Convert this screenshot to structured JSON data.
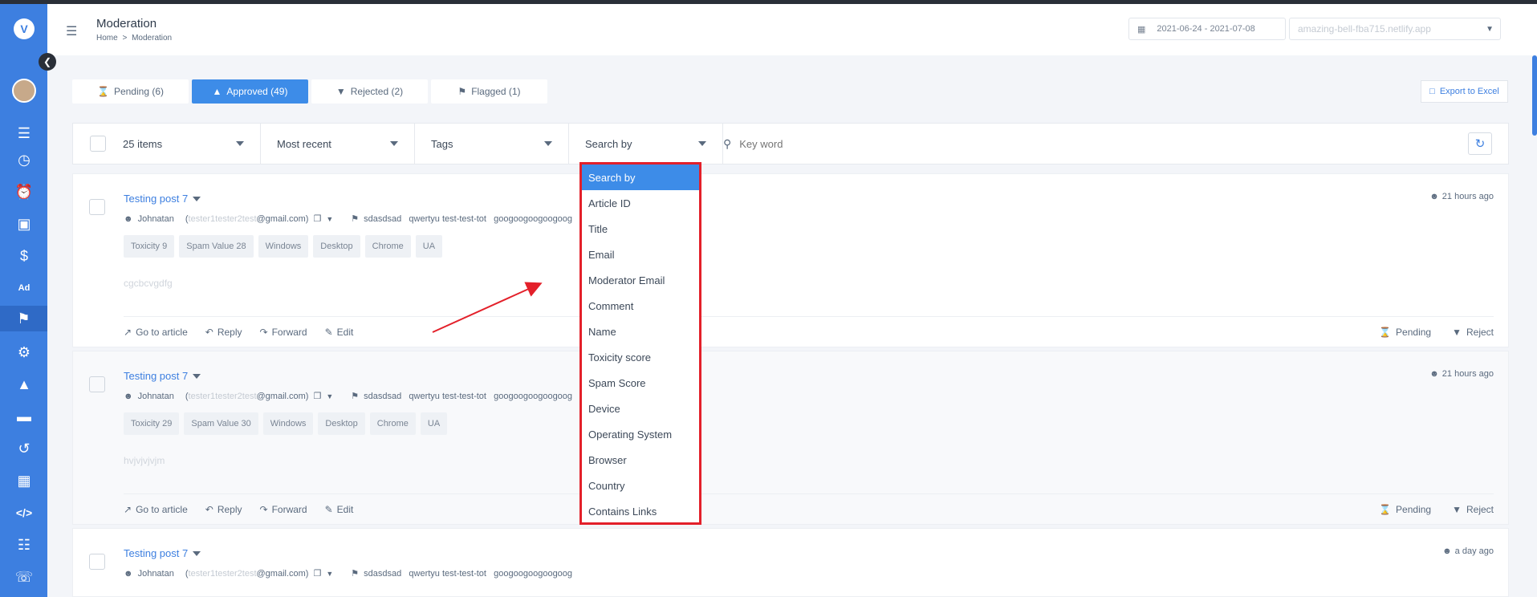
{
  "header": {
    "title": "Moderation",
    "breadcrumb_home": "Home",
    "breadcrumb_sep": ">",
    "breadcrumb_current": "Moderation",
    "date_range": "2021-06-24 - 2021-07-08",
    "site": "amazing-bell-fba715.netlify.app"
  },
  "tabs": [
    {
      "label": "Pending (6)",
      "icon": "hourglass-icon"
    },
    {
      "label": "Approved (49)",
      "icon": "thumbs-up-icon"
    },
    {
      "label": "Rejected (2)",
      "icon": "thumbs-down-icon"
    },
    {
      "label": "Flagged (1)",
      "icon": "flag-icon"
    }
  ],
  "export_label": "Export to Excel",
  "filters": {
    "items": "25 items",
    "sort": "Most recent",
    "tags": "Tags",
    "search_by": "Search by",
    "keyword_placeholder": "Key word"
  },
  "dropdown": {
    "options": [
      "Search by",
      "Article ID",
      "Title",
      "Email",
      "Moderator Email",
      "Comment",
      "Name",
      "Toxicity score",
      "Spam Score",
      "Device",
      "Operating System",
      "Browser",
      "Country",
      "Contains Links"
    ]
  },
  "posts": [
    {
      "title": "Testing post 7",
      "author": "Johnatan",
      "email_prefix": "(",
      "email_muted": "tester1tester2test",
      "email_rest": "@gmail.com)",
      "tags_line": "sdasdsad   qwertyu test-test-tot   googoogoogoogoog",
      "chips": [
        "Toxicity 9",
        "Spam Value 28",
        "Windows",
        "Desktop",
        "Chrome",
        "UA"
      ],
      "body": "cgcbcvgdfg",
      "time": "21 hours ago"
    },
    {
      "title": "Testing post 7",
      "author": "Johnatan",
      "email_prefix": "(",
      "email_muted": "tester1tester2test",
      "email_rest": "@gmail.com)",
      "tags_line": "sdasdsad   qwertyu test-test-tot   googoogoogoogoog",
      "chips": [
        "Toxicity 29",
        "Spam Value 30",
        "Windows",
        "Desktop",
        "Chrome",
        "UA"
      ],
      "body": "hvjvjvjvjm",
      "time": "21 hours ago"
    },
    {
      "title": "Testing post 7",
      "author": "Johnatan",
      "email_prefix": "(",
      "email_muted": "tester1tester2test",
      "email_rest": "@gmail.com)",
      "tags_line": "sdasdsad   qwertyu test-test-tot   googoogoogoogoog",
      "time": "a day ago"
    }
  ],
  "actions": {
    "goto": "Go to article",
    "reply": "Reply",
    "forward": "Forward",
    "edit": "Edit",
    "pending": "Pending",
    "reject": "Reject"
  },
  "colors": {
    "accent": "#3d8ce8",
    "sidebar": "#3d7fe0",
    "annotation": "#e3202a"
  }
}
